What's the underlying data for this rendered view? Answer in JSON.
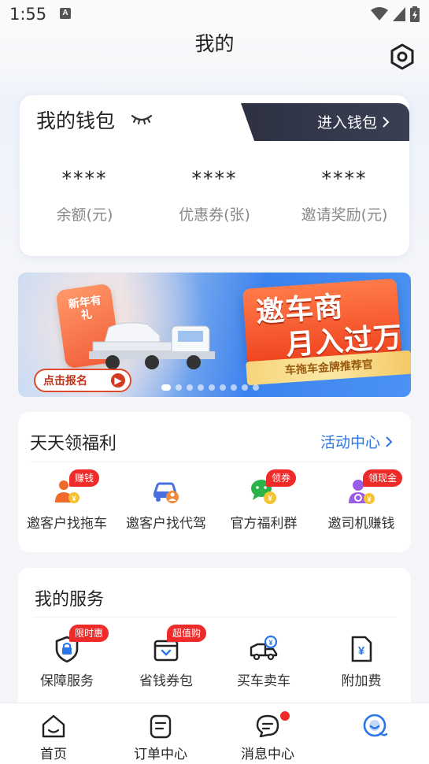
{
  "status_bar": {
    "time": "1:55",
    "notification_letter": "A"
  },
  "header": {
    "title": "我的"
  },
  "icons": {
    "settings": "settings-icon",
    "eye_closed": "eye-closed-icon",
    "chevron": "chevron-right-icon"
  },
  "wallet": {
    "title": "我的钱包",
    "enter_label": "进入钱包",
    "stats": [
      {
        "value": "****",
        "label": "余额(元)"
      },
      {
        "value": "****",
        "label": "优惠券(张)"
      },
      {
        "value": "****",
        "label": "邀请奖励(元)"
      }
    ]
  },
  "banner": {
    "left_badge": "新年有礼",
    "cta": "点击报名",
    "headline_line1": "邀车商",
    "headline_line2": "月入过万",
    "ribbon": "车拖车金牌推荐官",
    "pager": {
      "count": 9,
      "active_index": 0
    }
  },
  "welfare": {
    "title": "天天领福利",
    "link": "活动中心",
    "items": [
      {
        "label": "邀客户找拖车",
        "badge": "赚钱",
        "icon": "person-coin-icon"
      },
      {
        "label": "邀客户找代驾",
        "badge": "",
        "icon": "car-person-icon"
      },
      {
        "label": "官方福利群",
        "badge": "领券",
        "icon": "wechat-coin-icon"
      },
      {
        "label": "邀司机赚钱",
        "badge": "领现金",
        "icon": "driver-coin-icon"
      }
    ]
  },
  "services": {
    "title": "我的服务",
    "items": [
      {
        "label": "保障服务",
        "badge": "限时惠",
        "icon": "shield-lock-icon"
      },
      {
        "label": "省钱券包",
        "badge": "超值购",
        "icon": "coupon-wallet-icon"
      },
      {
        "label": "买车卖车",
        "badge": "",
        "icon": "truck-yuan-icon"
      },
      {
        "label": "附加费",
        "badge": "",
        "icon": "document-yuan-icon"
      }
    ]
  },
  "tabbar": {
    "items": [
      {
        "label": "首页",
        "icon": "home-icon"
      },
      {
        "label": "订单中心",
        "icon": "order-icon"
      },
      {
        "label": "消息中心",
        "icon": "message-icon",
        "has_dot": true
      },
      {
        "label": "",
        "icon": "profile-active-icon",
        "active": true
      }
    ]
  },
  "colors": {
    "accent_blue": "#2a76e8",
    "badge_red": "#ee2a2a",
    "wallet_tab_dark": "#2d3142"
  }
}
